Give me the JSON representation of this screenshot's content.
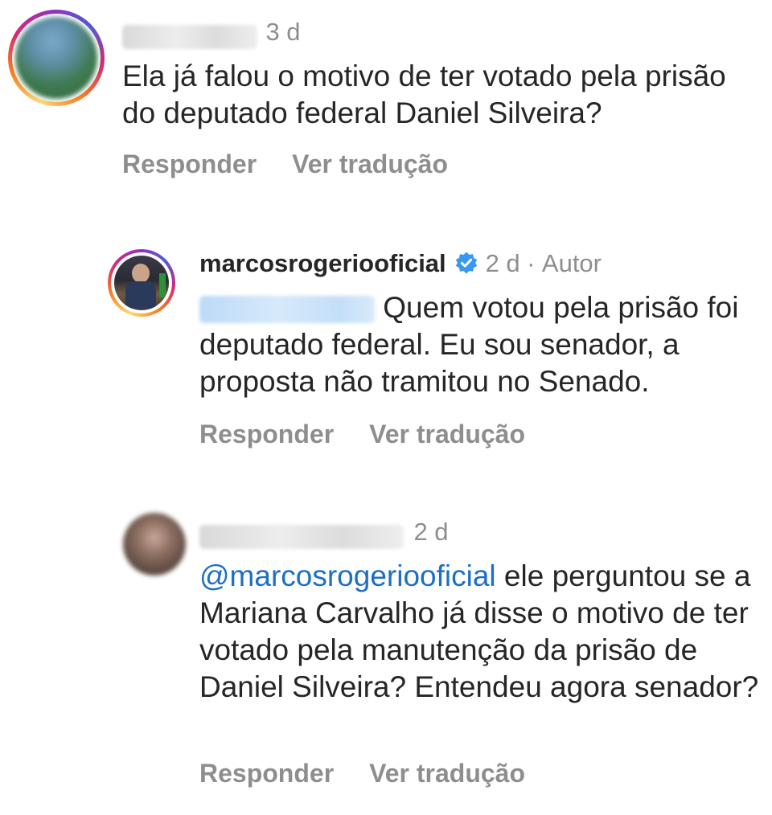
{
  "comments": [
    {
      "time": "3 d",
      "text": "Ela já falou o motivo de ter votado pela prisão do deputado federal Daniel Silveira?",
      "reply_label": "Responder",
      "translate_label": "Ver tradução"
    },
    {
      "username": "marcosrogeriooficial",
      "time": "2 d",
      "separator": "·",
      "author_badge": "Autor",
      "text": "Quem votou pela prisão foi deputado federal. Eu sou senador, a proposta não tramitou no Senado.",
      "reply_label": "Responder",
      "translate_label": "Ver tradução"
    },
    {
      "time": "2 d",
      "mention": "@marcosrogeriooficial",
      "text": "ele perguntou se a Mariana Carvalho já disse o motivo de ter votado pela manutenção da prisão de Daniel Silveira? Entendeu agora senador?",
      "reply_label": "Responder",
      "translate_label": "Ver tradução"
    }
  ],
  "colors": {
    "text": "#262626",
    "muted": "#8e8e8e",
    "mention": "#1d6fc4",
    "verified": "#3897f0"
  },
  "icons": [
    "verified-badge-icon"
  ]
}
